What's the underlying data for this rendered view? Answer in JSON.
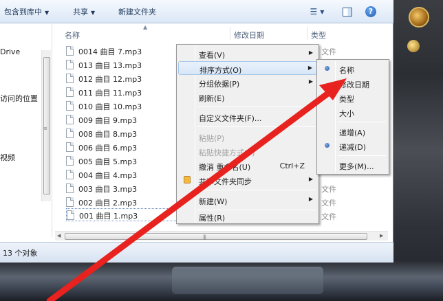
{
  "toolbar": {
    "include_library": "包含到库中",
    "share": "共享",
    "new_folder": "新建文件夹"
  },
  "nav": {
    "items": [
      "Drive",
      "访问的位置",
      "视频"
    ]
  },
  "columns": {
    "name": "名称",
    "date_modified": "修改日期",
    "type": "类型"
  },
  "files": [
    {
      "name": "0014 曲目 7.mp3",
      "type": "P3 文件"
    },
    {
      "name": "013 曲目 13.mp3",
      "type": ""
    },
    {
      "name": "012 曲目 12.mp3",
      "type": ""
    },
    {
      "name": "011 曲目 11.mp3",
      "type": ""
    },
    {
      "name": "010 曲目 10.mp3",
      "type": ""
    },
    {
      "name": "009 曲目 9.mp3",
      "type": ""
    },
    {
      "name": "008 曲目 8.mp3",
      "type": ""
    },
    {
      "name": "006 曲目 6.mp3",
      "type": ""
    },
    {
      "name": "005 曲目 5.mp3",
      "type": ""
    },
    {
      "name": "004 曲目 4.mp3",
      "type": ""
    },
    {
      "name": "003 曲目 3.mp3",
      "type": "P3 文件"
    },
    {
      "name": "002 曲目 2.mp3",
      "type": "P3 文件"
    },
    {
      "name": "001 曲目 1.mp3",
      "type": "P3 文件"
    }
  ],
  "status": {
    "count": "13 个对象"
  },
  "context_menu": {
    "view": "查看(V)",
    "sort_by": "排序方式(O)",
    "group_by": "分组依据(P)",
    "refresh": "刷新(E)",
    "customize": "自定义文件夹(F)...",
    "paste": "粘贴(P)",
    "paste_shortcut": "粘贴快捷方式(S)",
    "undo": "撤消 重命名(U)",
    "undo_shortcut": "Ctrl+Z",
    "share_sync": "共享文件夹同步",
    "new": "新建(W)",
    "properties": "属性(R)"
  },
  "sort_menu": {
    "name": "名称",
    "date": "修改日期",
    "type": "类型",
    "size": "大小",
    "ascending": "递增(A)",
    "descending": "递减(D)",
    "more": "更多(M)..."
  },
  "colors": {
    "arrow": "#e8221e",
    "menu_highlight": "#d7e6f7"
  }
}
